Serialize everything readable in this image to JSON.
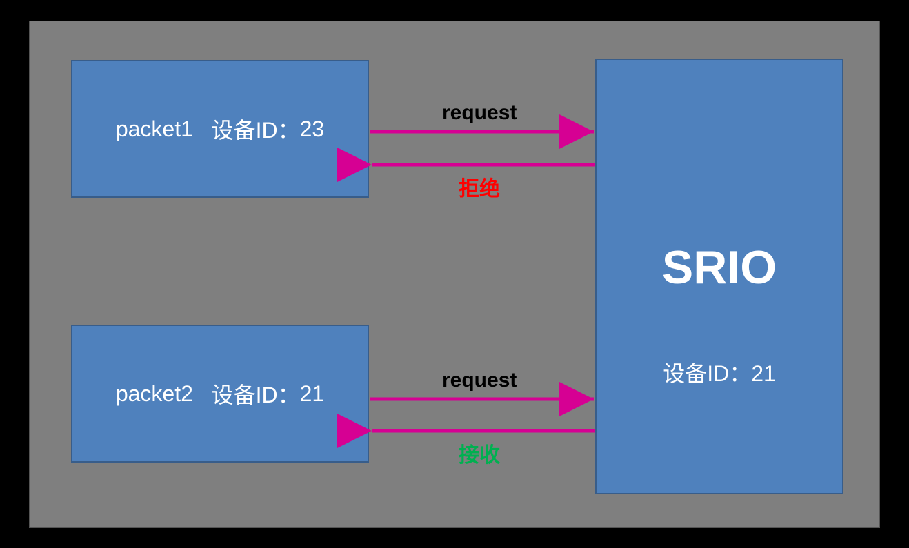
{
  "packet1": {
    "name": "packet1",
    "device_label": "设备ID：",
    "device_id": "23"
  },
  "packet2": {
    "name": "packet2",
    "device_label": "设备ID：",
    "device_id": "21"
  },
  "srio": {
    "title": "SRIO",
    "device_label": "设备ID：",
    "device_id": "21"
  },
  "labels": {
    "request1": "request",
    "reject": "拒绝",
    "request2": "request",
    "accept": "接收"
  },
  "colors": {
    "box_fill": "#4f81bd",
    "box_border": "#385d8a",
    "arrow": "#d60093",
    "bg": "#7f7f7f",
    "reject": "#ff0000",
    "accept": "#00b050"
  }
}
